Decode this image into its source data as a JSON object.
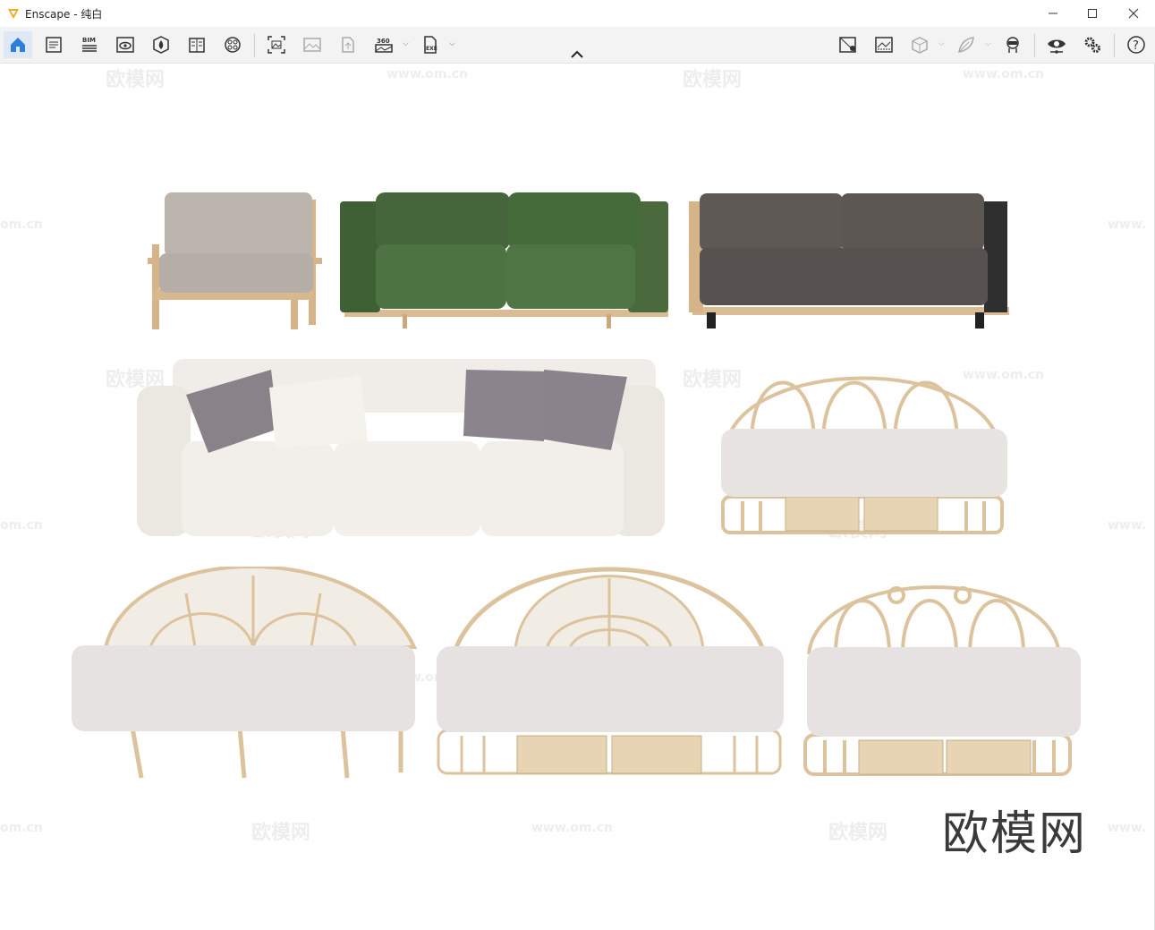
{
  "window": {
    "app_name": "Enscape",
    "separator": " - ",
    "scene_name": "纯白",
    "brand_color": "#f5a623"
  },
  "toolbar": {
    "left_icons": [
      "home-icon",
      "notes-icon",
      "bim-icon",
      "view-icon",
      "asset-icon",
      "library-icon",
      "material-icon"
    ],
    "render_icons": [
      "screenshot-icon",
      "image-icon",
      "upload-icon",
      "panorama-360-icon",
      "exe-export-icon"
    ],
    "right_icons": [
      "map-icon",
      "capture-icon",
      "box-icon",
      "leaf-icon",
      "vr-icon",
      "visual-settings-icon",
      "settings-icon",
      "help-icon"
    ],
    "bim_label": "BIM",
    "p360_label": "360",
    "exe_label": "EXE",
    "help_label": "?"
  },
  "watermarks": {
    "site_cn": "欧模网",
    "site_url": "www.om.cn",
    "url_fragment": "om.cn",
    "url_prefix": "www."
  },
  "brand_mark": "欧模网",
  "furniture": [
    {
      "name": "armchair",
      "cushion": "#b9b3ab"
    },
    {
      "name": "green-sofa",
      "cushion": "#4a6d3e"
    },
    {
      "name": "grey-sofa",
      "cushion": "#5c5754"
    },
    {
      "name": "white-sectional",
      "cushion": "#eeebe5"
    },
    {
      "name": "rattan-sofa-small",
      "cushion": "#e8e4e2"
    },
    {
      "name": "rattan-sofa-fan",
      "cushion": "#e6e2e1"
    },
    {
      "name": "rattan-sofa-arch",
      "cushion": "#e6e2e1"
    },
    {
      "name": "rattan-sofa-loop",
      "cushion": "#e6e2e1"
    }
  ]
}
